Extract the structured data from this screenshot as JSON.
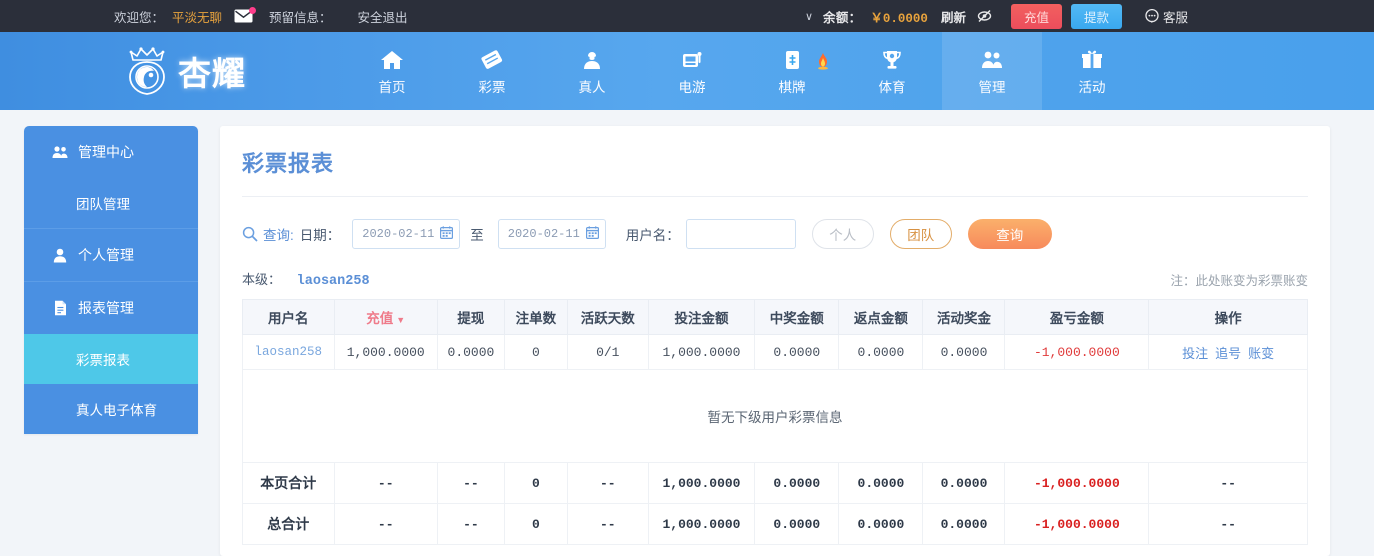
{
  "topbar": {
    "welcome": "欢迎您：",
    "username": "平淡无聊",
    "mail_icon": "mail-icon",
    "reserved_info": "预留信息：",
    "logout": "安全退出",
    "chevron": "∨",
    "balance_label": "余额：",
    "balance_value": "￥0.0000",
    "refresh": "刷新",
    "eye_icon": "eye-slash-icon",
    "deposit": "充值",
    "withdraw": "提款",
    "service_icon": "chat-icon",
    "service": "客服"
  },
  "brand": {
    "logo_text": "杏耀",
    "logo_icon": "crown-shield-icon"
  },
  "nav": {
    "items": [
      {
        "label": "首页",
        "icon": "home-icon",
        "active": false
      },
      {
        "label": "彩票",
        "icon": "ticket-icon",
        "active": false
      },
      {
        "label": "真人",
        "icon": "person-card-icon",
        "active": false
      },
      {
        "label": "电游",
        "icon": "slot-machine-icon",
        "active": false
      },
      {
        "label": "棋牌",
        "icon": "mahjong-tile-icon",
        "active": false,
        "hot": true
      },
      {
        "label": "体育",
        "icon": "trophy-icon",
        "active": false
      },
      {
        "label": "管理",
        "icon": "users-icon",
        "active": true
      },
      {
        "label": "活动",
        "icon": "gift-icon",
        "active": false
      }
    ]
  },
  "sidebar": {
    "groups": [
      {
        "items": [
          {
            "label": "管理中心",
            "icon": "users-icon",
            "sub": false,
            "active": false
          },
          {
            "label": "团队管理",
            "icon": "",
            "sub": true,
            "active": false
          }
        ]
      },
      {
        "items": [
          {
            "label": "个人管理",
            "icon": "user-icon",
            "sub": false,
            "active": false
          }
        ]
      },
      {
        "items": [
          {
            "label": "报表管理",
            "icon": "document-icon",
            "sub": false,
            "active": false
          },
          {
            "label": "彩票报表",
            "icon": "",
            "sub": true,
            "active": true
          },
          {
            "label": "真人电子体育",
            "icon": "",
            "sub": true,
            "active": false
          }
        ]
      }
    ]
  },
  "main": {
    "title": "彩票报表",
    "filter": {
      "search_icon": "search-icon",
      "query_label": "查询:",
      "date_label": "日期：",
      "date_from": "2020-02-11",
      "date_to": "2020-02-11",
      "calendar_icon": "calendar-icon",
      "between": "至",
      "username_label": "用户名：",
      "username_value": "",
      "username_placeholder": "",
      "btn_personal": "个人",
      "btn_team": "团队",
      "btn_query": "查询"
    },
    "info": {
      "level_label": "本级：",
      "level_user": "laosan258",
      "note": "注：此处账变为彩票账变"
    },
    "table": {
      "columns": [
        {
          "label": "用户名",
          "sorted": false
        },
        {
          "label": "充值",
          "sorted": true,
          "arrow": "▼"
        },
        {
          "label": "提现",
          "sorted": false
        },
        {
          "label": "注单数",
          "sorted": false
        },
        {
          "label": "活跃天数",
          "sorted": false
        },
        {
          "label": "投注金额",
          "sorted": false
        },
        {
          "label": "中奖金额",
          "sorted": false
        },
        {
          "label": "返点金额",
          "sorted": false
        },
        {
          "label": "活动奖金",
          "sorted": false
        },
        {
          "label": "盈亏金额",
          "sorted": false
        },
        {
          "label": "操作",
          "sorted": false
        }
      ],
      "rows": [
        {
          "username": "laosan258",
          "recharge": "1,000.0000",
          "withdraw": "0.0000",
          "bet_count": "0",
          "active_days": "0/1",
          "bet_amount": "1,000.0000",
          "win_amount": "0.0000",
          "rebate": "0.0000",
          "bonus": "0.0000",
          "profit": "-1,000.0000",
          "actions": [
            "投注",
            "追号",
            "账变"
          ]
        }
      ],
      "empty_text": "暂无下级用户彩票信息",
      "summaries": [
        {
          "label": "本页合计",
          "recharge": "--",
          "withdraw": "--",
          "bet_count": "0",
          "active_days": "--",
          "bet_amount": "1,000.0000",
          "win_amount": "0.0000",
          "rebate": "0.0000",
          "bonus": "0.0000",
          "profit": "-1,000.0000",
          "actions": "--"
        },
        {
          "label": "总合计",
          "recharge": "--",
          "withdraw": "--",
          "bet_count": "0",
          "active_days": "--",
          "bet_amount": "1,000.0000",
          "win_amount": "0.0000",
          "rebate": "0.0000",
          "bonus": "0.0000",
          "profit": "-1,000.0000",
          "actions": "--"
        }
      ]
    }
  },
  "colors": {
    "nav_blue": "#4a90e2",
    "sidebar_active": "#4ec8e8",
    "accent_orange": "#f78a5c",
    "negative_red": "#e03b3b",
    "topbar_dark": "#2b2f3a"
  }
}
